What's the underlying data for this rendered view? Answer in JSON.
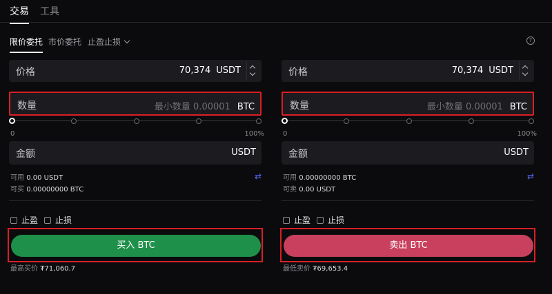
{
  "tabs": {
    "trade": "交易",
    "tools": "工具"
  },
  "order_types": {
    "limit": "限价委托",
    "market": "市价委托",
    "stop": "止盈止损"
  },
  "help_icon": "?",
  "buy": {
    "price_label": "价格",
    "price_value": "70,374",
    "price_unit": "USDT",
    "qty_label": "数量",
    "qty_placeholder": "最小数量 0.00001",
    "qty_unit": "BTC",
    "slider_min": "0",
    "slider_max": "100%",
    "slider_value": 0,
    "amount_label": "金额",
    "amount_unit": "USDT",
    "avail_label": "可用",
    "avail_value": "0.00 USDT",
    "can_label": "可买",
    "can_value": "0.00000000 BTC",
    "tp_label": "止盈",
    "sl_label": "止损",
    "button_label": "买入 BTC",
    "best_label": "最高买价",
    "best_value": "₮71,060.7"
  },
  "sell": {
    "price_label": "价格",
    "price_value": "70,374",
    "price_unit": "USDT",
    "qty_label": "数量",
    "qty_placeholder": "最小数量 0.00001",
    "qty_unit": "BTC",
    "slider_min": "0",
    "slider_max": "100%",
    "slider_value": 0,
    "amount_label": "金额",
    "amount_unit": "USDT",
    "avail_label": "可用",
    "avail_value": "0.00000000 BTC",
    "can_label": "可卖",
    "can_value": "0.00 USDT",
    "tp_label": "止盈",
    "sl_label": "止损",
    "button_label": "卖出 BTC",
    "best_label": "最低卖价",
    "best_value": "₮69,653.4"
  },
  "colors": {
    "buy": "#1f9049",
    "sell": "#c8405d",
    "highlight": "#d91f26",
    "accent": "#5865f2"
  },
  "icons": {
    "swap": "swap-icon",
    "help": "help-icon",
    "chevron": "chevron-down-icon"
  }
}
